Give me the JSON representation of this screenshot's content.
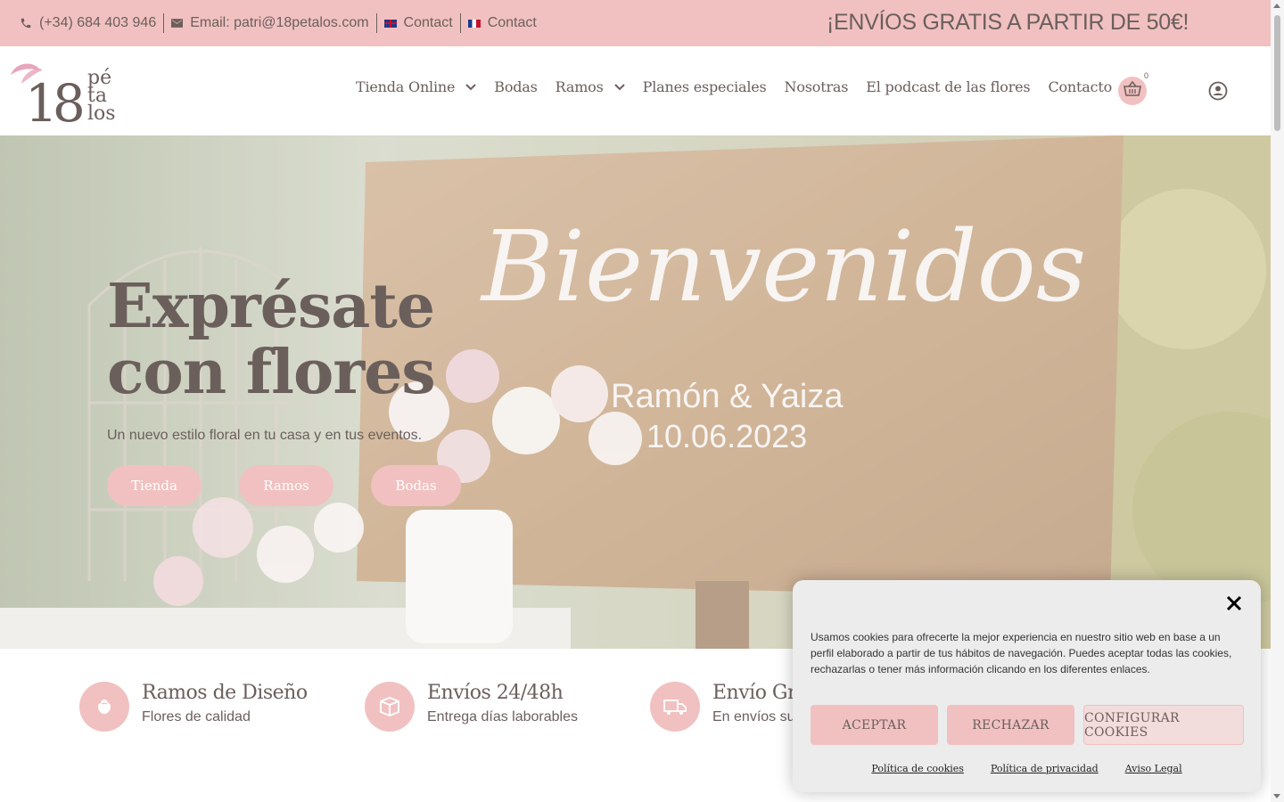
{
  "topbar": {
    "phone": "(+34) 684 403 946",
    "email": "Email: patri@18petalos.com",
    "contact_en": "Contact",
    "contact_fr": "Contact",
    "promo": "¡ENVÍOS GRATIS A PARTIR DE 50€!"
  },
  "logo": {
    "number": "18",
    "line1": "pé",
    "line2": "ta",
    "line3": "los"
  },
  "nav": {
    "items": [
      {
        "label": "Tienda Online",
        "dropdown": true
      },
      {
        "label": "Bodas",
        "dropdown": false
      },
      {
        "label": "Ramos",
        "dropdown": true
      },
      {
        "label": "Planes especiales",
        "dropdown": false
      },
      {
        "label": "Nosotras",
        "dropdown": false
      },
      {
        "label": "El podcast de las flores",
        "dropdown": false
      },
      {
        "label": "Contacto",
        "dropdown": false
      }
    ],
    "cart_count": "0"
  },
  "hero": {
    "title": "Exprésate con flores",
    "subtitle": "Un nuevo estilo floral en tu casa y en tus eventos.",
    "buttons": [
      "Tienda",
      "Ramos",
      "Bodas"
    ],
    "sign_text": "Bienvenidos",
    "sign_names": "Ramón & Yaiza",
    "sign_date": "10.06.2023"
  },
  "features": [
    {
      "title": "Ramos de Diseño",
      "subtitle": "Flores de calidad",
      "icon": "flower-icon"
    },
    {
      "title": "Envíos 24/48h",
      "subtitle": "Entrega días laborables",
      "icon": "box-icon"
    },
    {
      "title": "Envío Gr",
      "subtitle": "En envíos su",
      "icon": "truck-icon"
    }
  ],
  "cookie": {
    "text": "Usamos cookies para ofrecerte la mejor experiencia en nuestro sitio web en base a un perfil elaborado a partir de tus hábitos de navegación. Puedes aceptar todas las cookies, rechazarlas o tener más información clicando en los diferentes enlaces.",
    "accept": "ACEPTAR",
    "reject": "RECHAZAR",
    "configure": "CONFIGURAR COOKIES",
    "links": [
      "Política de cookies",
      "Política de privacidad",
      "Aviso Legal"
    ]
  },
  "colors": {
    "accent": "#f1c1c1",
    "text": "#6b5f5c"
  }
}
